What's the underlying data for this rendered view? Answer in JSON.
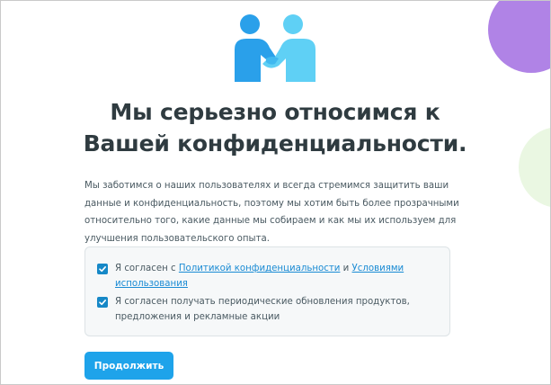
{
  "colors": {
    "accent": "#1ea3ea",
    "link": "#1a8bd4",
    "checkbox": "#1688c7",
    "title": "#2f3b40",
    "decor_purple": "#b083e6",
    "decor_green": "#eaf7e2",
    "figure_left": "#2aa0ea",
    "figure_right": "#5fd0f5"
  },
  "hero": {
    "icon": "handshake-people-icon"
  },
  "title": {
    "line1": "Мы серьезно относимся к",
    "line2": "Вашей конфиденциальности."
  },
  "description": "Мы заботимся о наших пользователях и всегда стремимся защитить ваши данные и конфиденциальность, поэтому мы хотим быть более прозрачными относительно того, какие данные мы собираем и как мы их используем для улучшения пользовательского опыта.",
  "consents": {
    "privacy": {
      "checked": true,
      "text_before": "Я согласен с ",
      "privacy_link": "Политикой конфиденциальности",
      "text_middle": " и ",
      "terms_link": "Условиями использования"
    },
    "updates": {
      "checked": true,
      "text": "Я согласен получать периодические обновления продуктов, предложения и рекламные акции"
    }
  },
  "continue_button": {
    "label": "Продолжить"
  }
}
